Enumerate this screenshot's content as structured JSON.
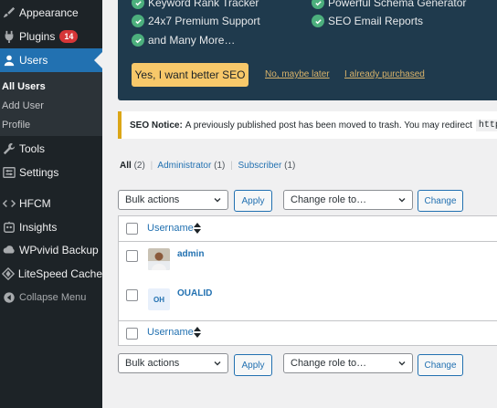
{
  "sidebar": {
    "items": [
      {
        "label": "Appearance",
        "icon": "paintbrush-icon"
      },
      {
        "label": "Plugins",
        "icon": "plugin-icon",
        "badge": "14"
      },
      {
        "label": "Users",
        "icon": "users-icon"
      },
      {
        "label": "Tools",
        "icon": "wrench-icon"
      },
      {
        "label": "Settings",
        "icon": "settings-icon"
      },
      {
        "label": "HFCM",
        "icon": "code-icon"
      },
      {
        "label": "Insights",
        "icon": "chart-icon"
      },
      {
        "label": "WPvivid Backup",
        "icon": "backup-icon"
      },
      {
        "label": "LiteSpeed Cache",
        "icon": "diamond-icon"
      }
    ],
    "submenu": [
      "All Users",
      "Add User",
      "Profile"
    ],
    "collapse_label": "Collapse Menu"
  },
  "promo": {
    "features": [
      "Keyword Rank Tracker",
      "24x7 Premium Support",
      "and Many More…",
      "Powerful Schema Generator",
      "SEO Email Reports"
    ],
    "cta_label": "Yes, I want better SEO",
    "maybe_later": "No, maybe later",
    "already_purchased": "I already purchased"
  },
  "notice": {
    "title": "SEO Notice:",
    "text": "A previously published post has been moved to trash. You may redirect",
    "code": "https:/"
  },
  "views": {
    "all": "All",
    "all_count": "(2)",
    "admin": "Administrator",
    "admin_count": "(1)",
    "subscriber": "Subscriber",
    "subscriber_count": "(1)"
  },
  "bulk": {
    "bulk_actions": "Bulk actions",
    "apply": "Apply",
    "change_role": "Change role to…",
    "change": "Change"
  },
  "table": {
    "header": "Username",
    "rows": [
      {
        "username": "admin"
      },
      {
        "username": "OUALID",
        "avatar_initials": "OH"
      }
    ]
  },
  "colors": {
    "sidebar": "#1d2327",
    "accent": "#2271b1",
    "badge": "#d63638",
    "promo_bg": "#1f3a4d",
    "cta": "#f7c86a"
  }
}
